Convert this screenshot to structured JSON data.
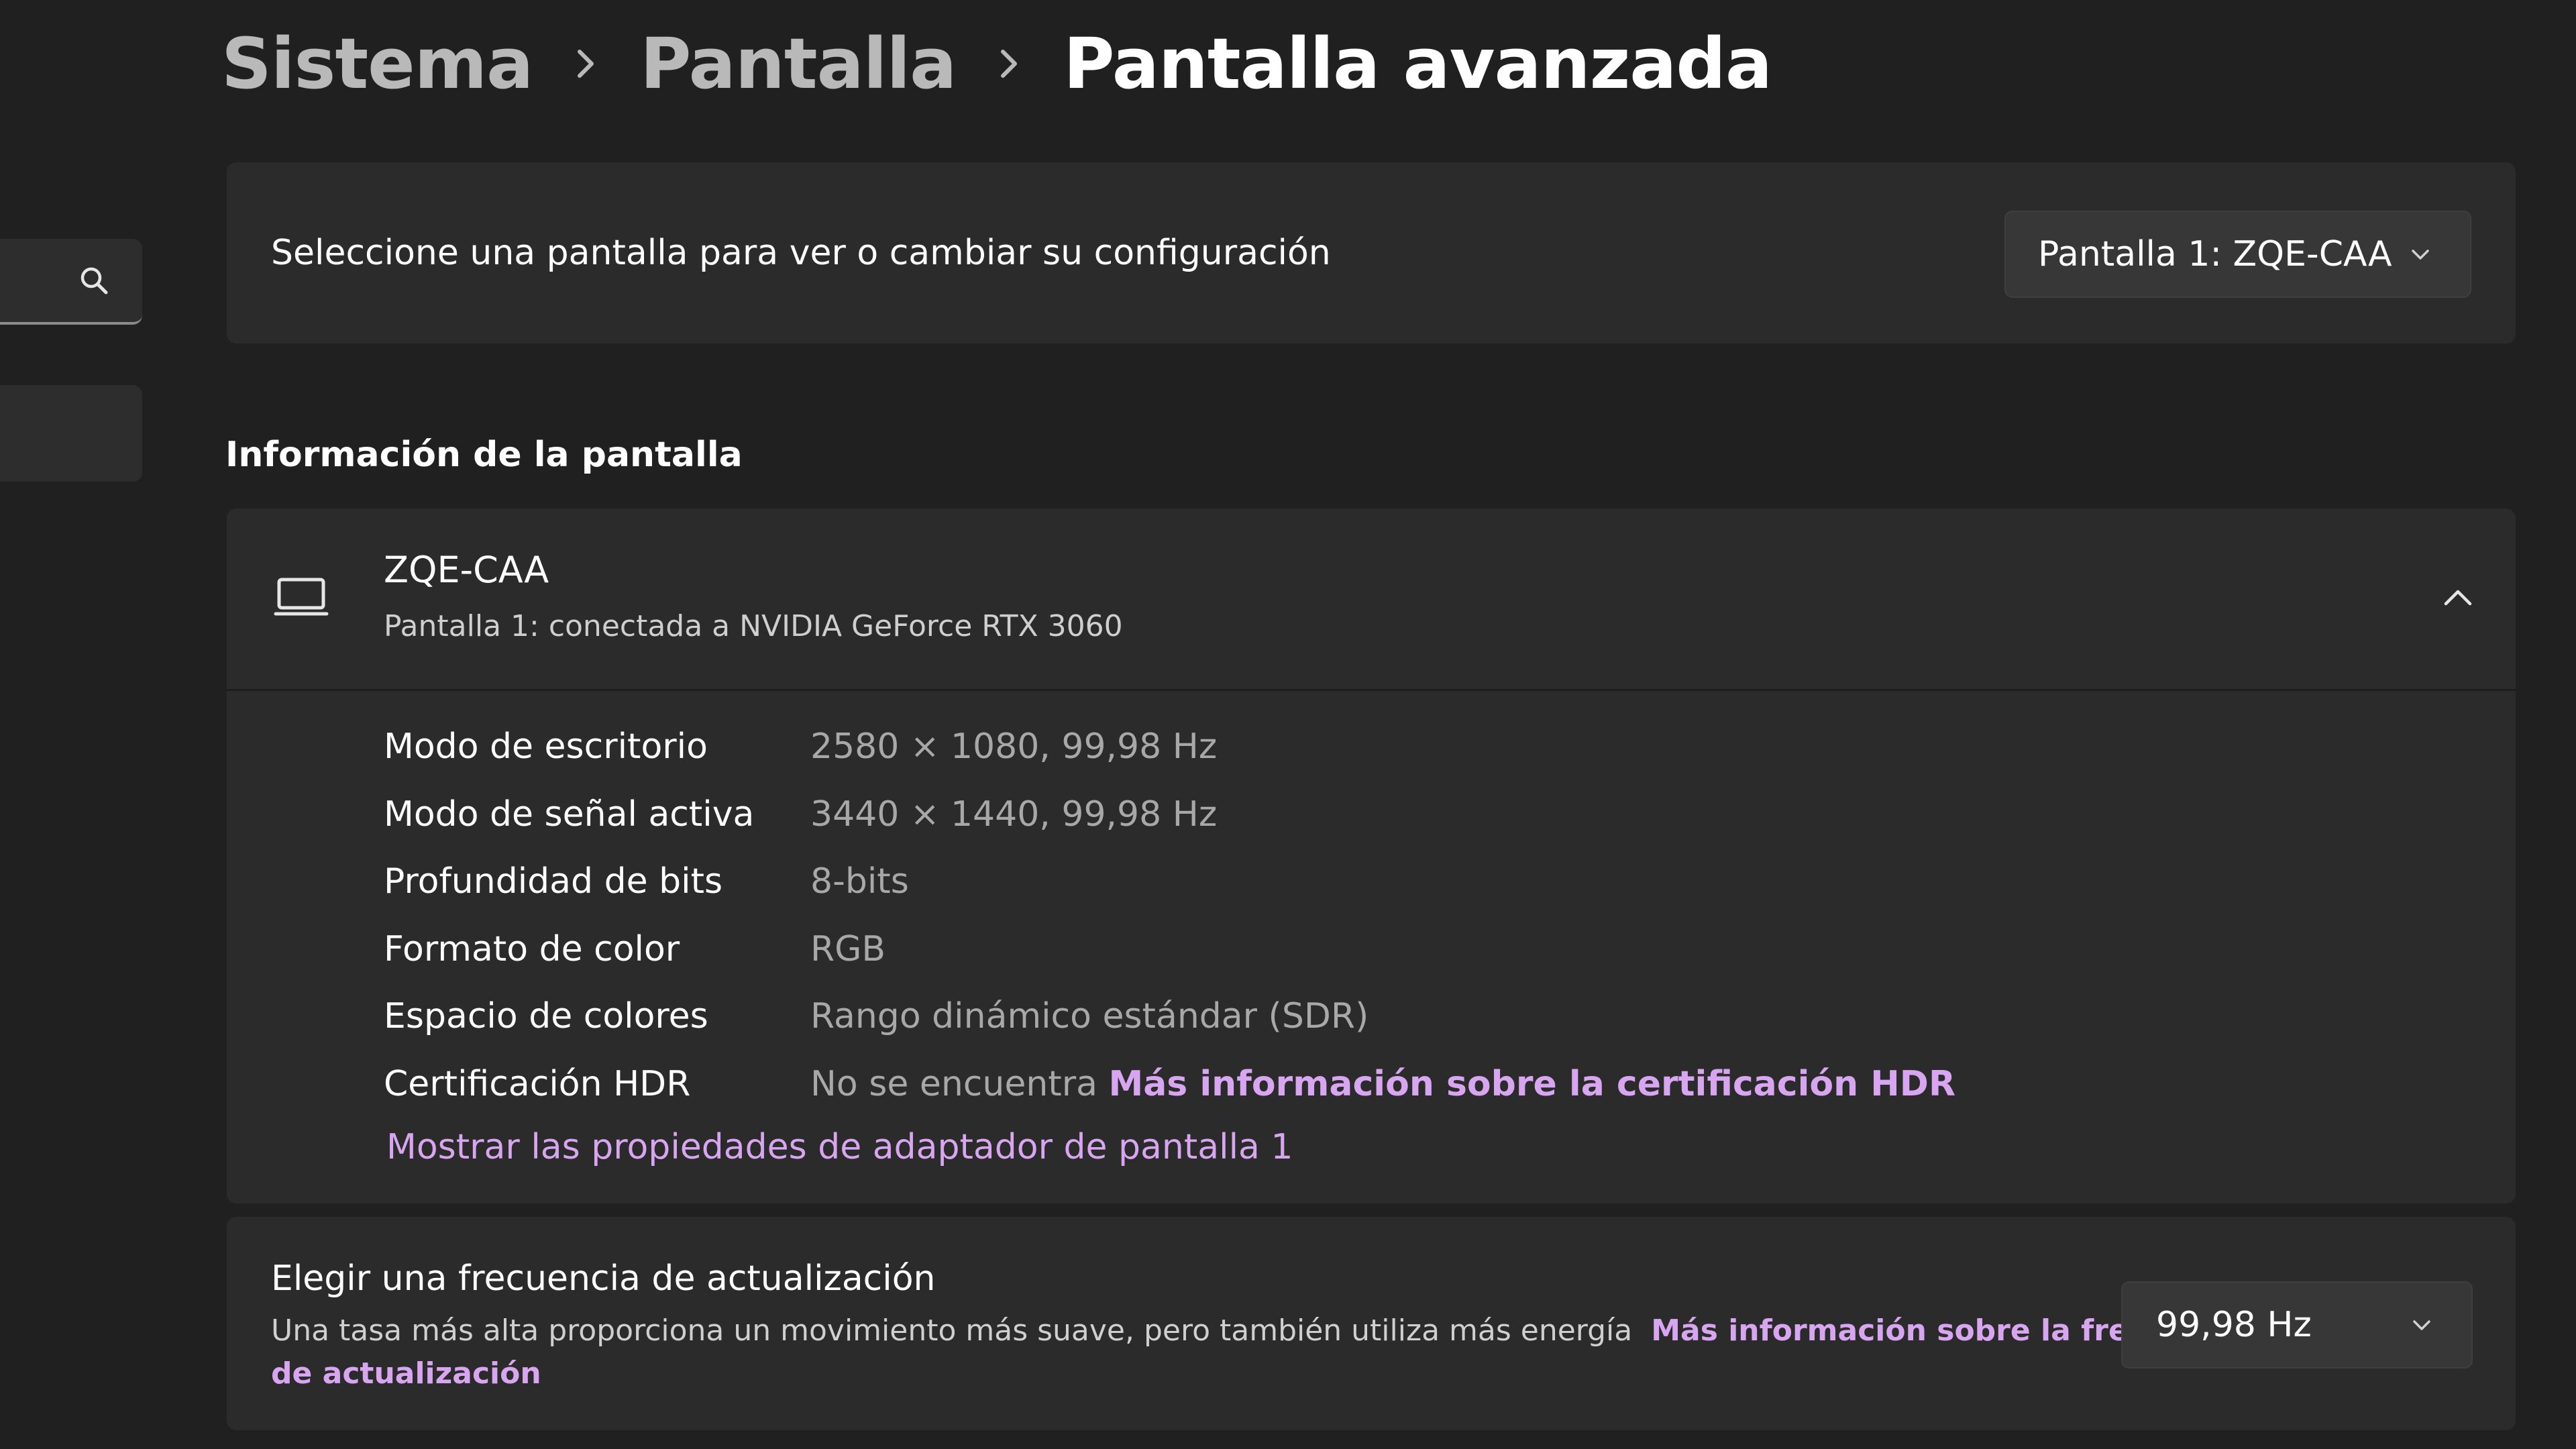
{
  "breadcrumb": {
    "items": [
      "Sistema",
      "Pantalla"
    ],
    "current": "Pantalla avanzada"
  },
  "display_select": {
    "label": "Seleccione una pantalla para ver o cambiar su configuración",
    "selected": "Pantalla 1: ZQE-CAA"
  },
  "info_section": {
    "title": "Información de la pantalla",
    "device_name": "ZQE-CAA",
    "device_subtitle": "Pantalla 1: conectada a NVIDIA GeForce RTX 3060",
    "rows": [
      {
        "key": "Modo de escritorio",
        "value": "2580 × 1080, 99,98 Hz"
      },
      {
        "key": "Modo de señal activa",
        "value": "3440 × 1440, 99,98 Hz"
      },
      {
        "key": "Profundidad de bits",
        "value": "8-bits"
      },
      {
        "key": "Formato de color",
        "value": "RGB"
      },
      {
        "key": "Espacio de colores",
        "value": "Rango dinámico estándar (SDR)"
      },
      {
        "key": "Certificación HDR",
        "value": "No se encuentra",
        "link": "Más información sobre la certificación HDR"
      }
    ],
    "adapter_link": "Mostrar las propiedades de adaptador de pantalla 1"
  },
  "refresh": {
    "title": "Elegir una frecuencia de actualización",
    "description": "Una tasa más alta proporciona un movimiento más suave, pero también utiliza más energía",
    "link": "Más información sobre la frecuencia de actualización",
    "selected": "99,98 Hz"
  },
  "colors": {
    "background": "#202020",
    "card": "#2b2b2b",
    "accent_link": "#d8a6f0",
    "secondary_text": "#a8a8a8"
  },
  "icons": [
    "search-icon",
    "chevron-right-icon",
    "chevron-down-icon",
    "laptop-icon",
    "chevron-up-icon"
  ]
}
